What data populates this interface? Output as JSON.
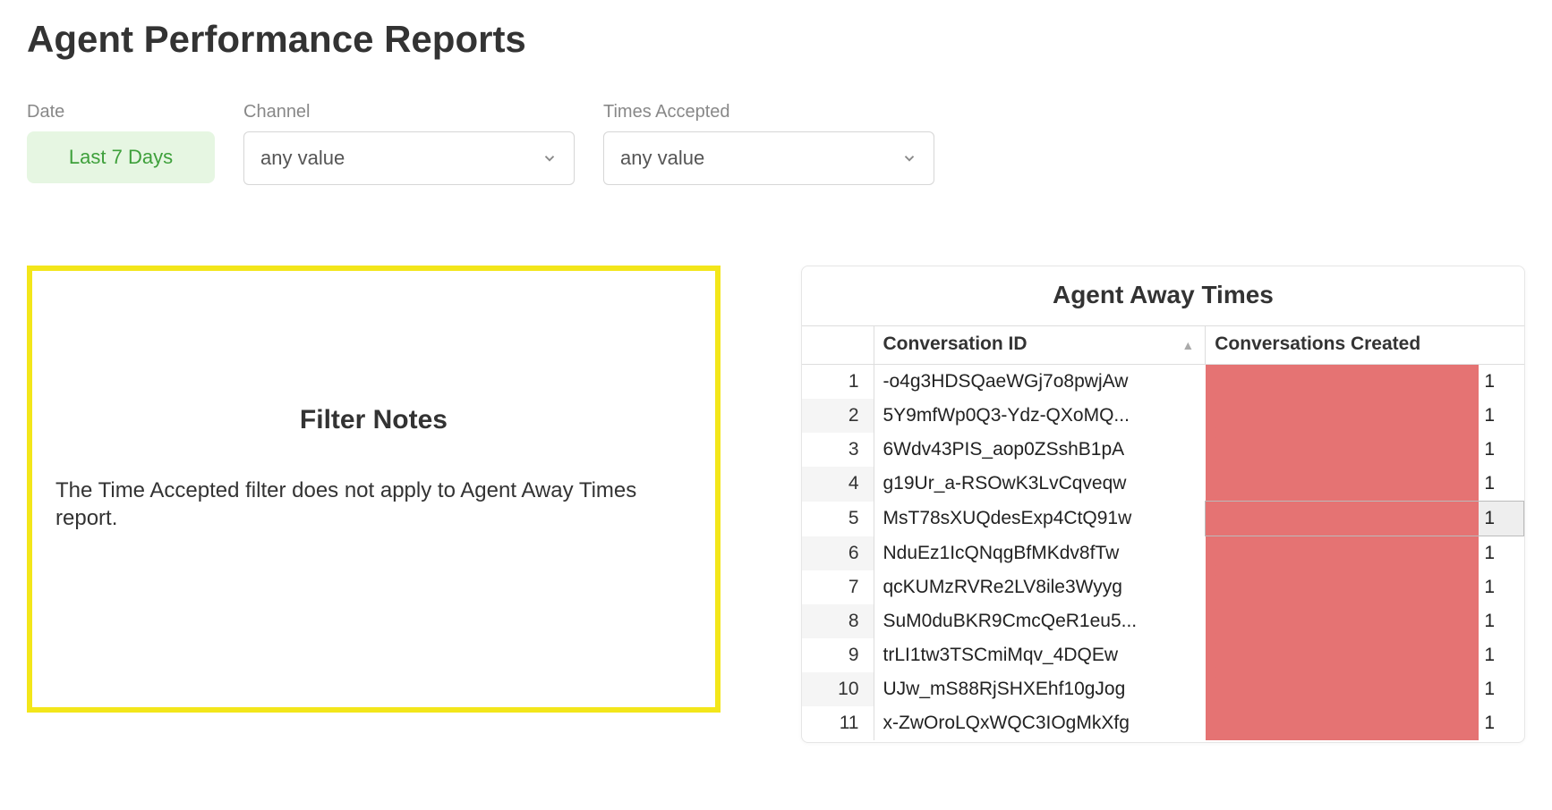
{
  "page": {
    "title": "Agent Performance Reports"
  },
  "filters": {
    "date": {
      "label": "Date",
      "value": "Last 7 Days"
    },
    "channel": {
      "label": "Channel",
      "value": "any value"
    },
    "times": {
      "label": "Times Accepted",
      "value": "any value"
    }
  },
  "note": {
    "title": "Filter Notes",
    "body": "The Time Accepted filter does not apply to Agent Away Times report."
  },
  "table": {
    "title": "Agent Away Times",
    "columns": {
      "conversation_id": "Conversation ID",
      "conversations_created": "Conversations Created"
    },
    "highlight_index": 5,
    "rows": [
      {
        "n": 1,
        "id": "-o4g3HDSQaeWGj7o8pwjAw",
        "count": 1
      },
      {
        "n": 2,
        "id": "5Y9mfWp0Q3-Ydz-QXoMQ...",
        "count": 1
      },
      {
        "n": 3,
        "id": "6Wdv43PIS_aop0ZSshB1pA",
        "count": 1
      },
      {
        "n": 4,
        "id": "g19Ur_a-RSOwK3LvCqveqw",
        "count": 1
      },
      {
        "n": 5,
        "id": "MsT78sXUQdesExp4CtQ91w",
        "count": 1
      },
      {
        "n": 6,
        "id": "NduEz1IcQNqgBfMKdv8fTw",
        "count": 1
      },
      {
        "n": 7,
        "id": "qcKUMzRVRe2LV8ile3Wyyg",
        "count": 1
      },
      {
        "n": 8,
        "id": "SuM0duBKR9CmcQeR1eu5...",
        "count": 1
      },
      {
        "n": 9,
        "id": "trLI1tw3TSCmiMqv_4DQEw",
        "count": 1
      },
      {
        "n": 10,
        "id": "UJw_mS88RjSHXEhf10gJog",
        "count": 1
      },
      {
        "n": 11,
        "id": "x-ZwOroLQxWQC3IOgMkXfg",
        "count": 1
      }
    ]
  },
  "chart_data": {
    "type": "bar",
    "title": "Agent Away Times",
    "xlabel": "Conversations Created",
    "ylabel": "Conversation ID",
    "categories": [
      "-o4g3HDSQaeWGj7o8pwjAw",
      "5Y9mfWp0Q3-Ydz-QXoMQ...",
      "6Wdv43PIS_aop0ZSshB1pA",
      "g19Ur_a-RSOwK3LvCqveqw",
      "MsT78sXUQdesExp4CtQ91w",
      "NduEz1IcQNqgBfMKdv8fTw",
      "qcKUMzRVRe2LV8ile3Wyyg",
      "SuM0duBKR9CmcQeR1eu5...",
      "trLI1tw3TSCmiMqv_4DQEw",
      "UJw_mS88RjSHXEhf10gJog",
      "x-ZwOroLQxWQC3IOgMkXfg"
    ],
    "values": [
      1,
      1,
      1,
      1,
      1,
      1,
      1,
      1,
      1,
      1,
      1
    ],
    "ylim": [
      0,
      1
    ]
  }
}
